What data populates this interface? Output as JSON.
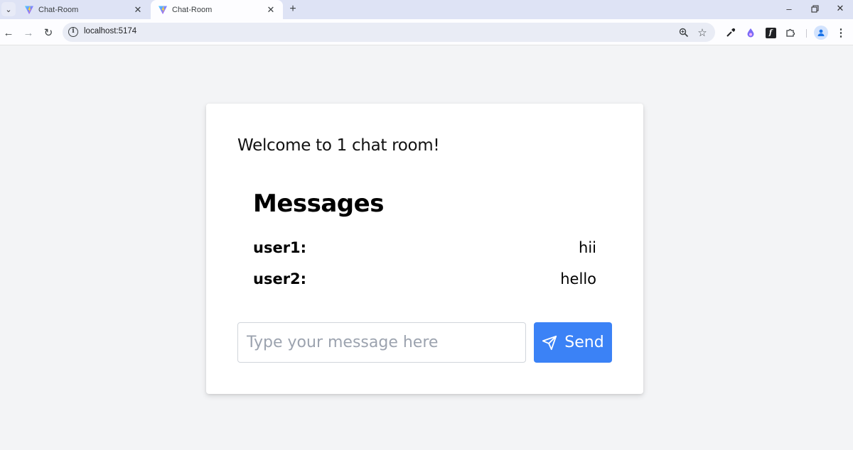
{
  "browser": {
    "tabs": [
      {
        "title": "Chat-Room",
        "active": false
      },
      {
        "title": "Chat-Room",
        "active": true
      }
    ],
    "address": "localhost:5174"
  },
  "page": {
    "welcome": "Welcome to 1 chat room!",
    "messages_title": "Messages",
    "messages": [
      {
        "user": "user1:",
        "text": "hii"
      },
      {
        "user": "user2:",
        "text": "hello"
      }
    ],
    "input": {
      "placeholder": "Type your message here",
      "value": ""
    },
    "send_label": "Send"
  },
  "colors": {
    "accent": "#3b82f6",
    "page_bg": "#f3f4f6",
    "tabstrip_bg": "#dee3f5"
  },
  "icons": [
    "tab-search-icon",
    "vite-favicon-icon",
    "close-icon",
    "new-tab-icon",
    "minimize-icon",
    "restore-icon",
    "window-close-icon",
    "back-arrow-icon",
    "forward-arrow-icon",
    "reload-icon",
    "site-info-icon",
    "zoom-icon",
    "bookmark-star-icon",
    "eyedropper-icon",
    "extension-drop-icon",
    "extension-font-icon",
    "puzzle-icon",
    "profile-avatar-icon",
    "more-menu-icon",
    "send-plane-icon"
  ]
}
